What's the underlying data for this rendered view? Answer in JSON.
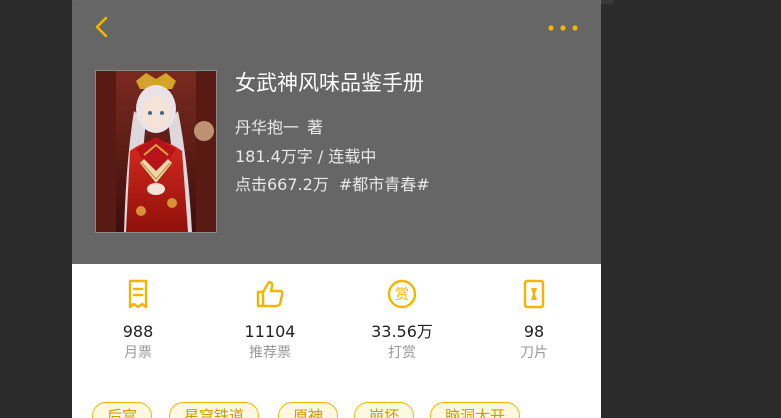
{
  "colors": {
    "accent": "#f5b400",
    "header_bg": "#666666",
    "page_bg": "#2b2b2b"
  },
  "nav": {
    "back_icon": "chevron-left-icon",
    "more_icon": "more-dots-icon"
  },
  "book": {
    "title": "女武神风味品鉴手册",
    "author": "丹华抱一",
    "author_suffix": "著",
    "word_status": "181.4万字 / 连载中",
    "clicks": "点击667.2万",
    "category": "#都市青春#"
  },
  "stats": [
    {
      "icon": "monthly-ticket-icon",
      "value": "988",
      "label": "月票"
    },
    {
      "icon": "thumbs-up-icon",
      "value": "11104",
      "label": "推荐票"
    },
    {
      "icon": "reward-coin-icon",
      "value": "33.56万",
      "label": "打赏"
    },
    {
      "icon": "blade-card-icon",
      "value": "98",
      "label": "刀片"
    }
  ],
  "tags": [
    "后宫",
    "星穹铁道",
    "原神",
    "崩坏",
    "脑洞大开"
  ]
}
